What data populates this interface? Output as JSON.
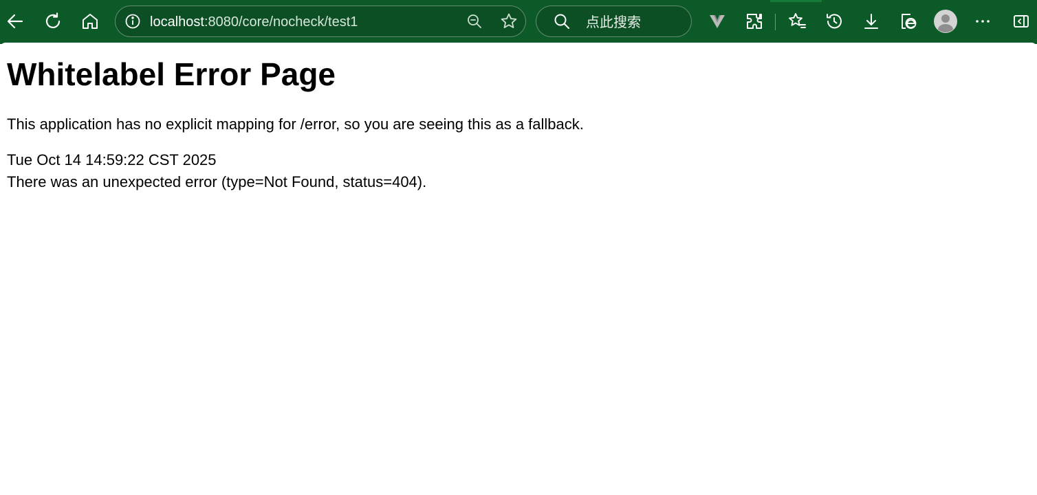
{
  "browser": {
    "address": {
      "host": "localhost",
      "path": ":8080/core/nocheck/test1"
    },
    "search": {
      "placeholder": "点此搜索"
    },
    "theme_color": "#0b5a27",
    "icons": {
      "back": "back-arrow-icon",
      "refresh": "refresh-icon",
      "home": "home-icon",
      "site_info": "info-icon",
      "zoom": "zoom-out-icon",
      "favorite": "star-icon",
      "search": "search-icon",
      "extension_v": "v-extension-icon",
      "extensions": "puzzle-icon",
      "favorites": "favorites-icon",
      "history": "history-icon",
      "downloads": "download-icon",
      "ie_mode": "ie-mode-icon",
      "profile": "avatar-icon",
      "more": "more-icon",
      "sidebar": "sidebar-toggle-icon"
    }
  },
  "page": {
    "title": "Whitelabel Error Page",
    "description": "This application has no explicit mapping for /error, so you are seeing this as a fallback.",
    "timestamp": "Tue Oct 14 14:59:22 CST 2025",
    "error_message": "There was an unexpected error (type=Not Found, status=404)."
  }
}
